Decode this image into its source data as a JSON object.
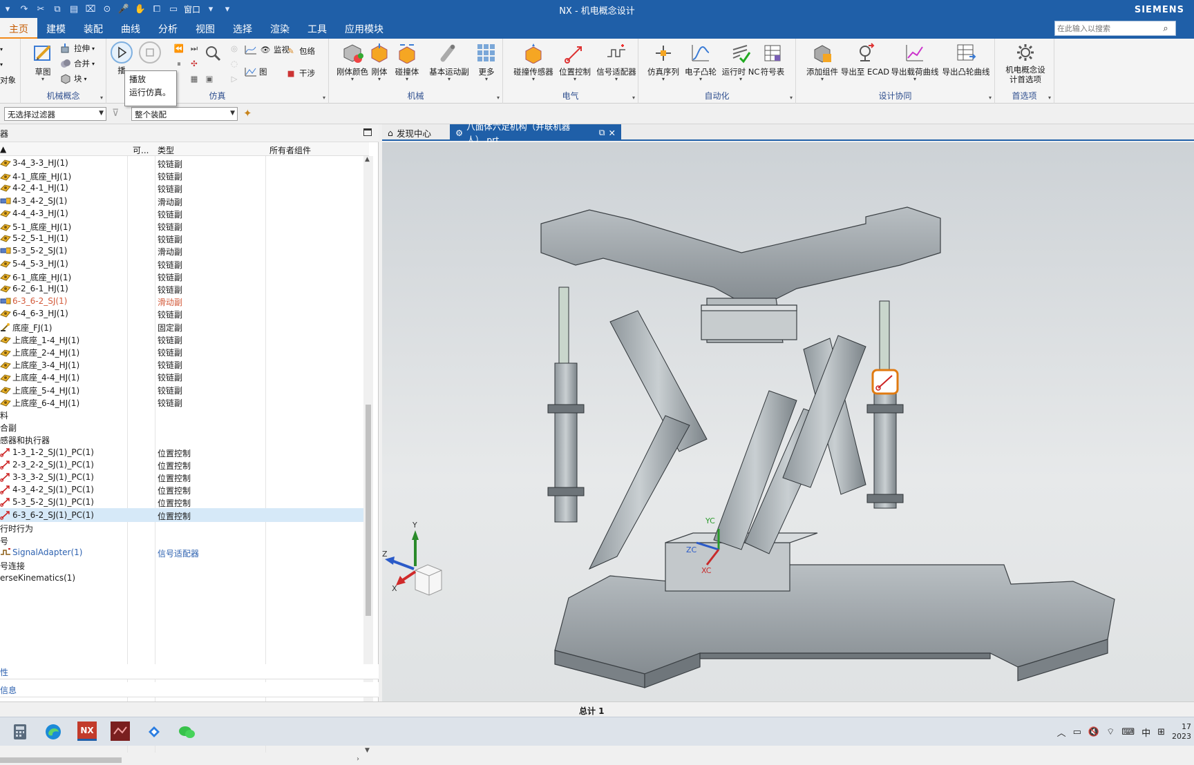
{
  "titlebar": {
    "title": "NX - 机电概念设计",
    "brand": "SIEMENS",
    "window_menu": "窗口"
  },
  "menu": {
    "tabs": [
      "主页",
      "建模",
      "装配",
      "曲线",
      "分析",
      "视图",
      "选择",
      "渲染",
      "工具",
      "应用模块"
    ],
    "active_tab": "主页",
    "search_placeholder": "在此输入以搜索"
  },
  "ribbon": {
    "group_labels": {
      "mech_concept": "机械概念",
      "simulation": "仿真",
      "mechanical": "机械",
      "electrical": "电气",
      "automation": "自动化",
      "design_collab": "设计协同",
      "preferences": "首选项"
    },
    "left_clip": {
      "obj": "对象"
    },
    "mech_concept": {
      "sketch": "草图",
      "extrude": "拉伸",
      "unite": "合并",
      "block": "块"
    },
    "simulation": {
      "play_clip": "播",
      "monitor": "监视",
      "chart": "图",
      "wrap": "包络",
      "interference": "干涉"
    },
    "mechanical": {
      "rigid_color": "刚体颜色",
      "rigid": "刚体",
      "collision": "碰撞体",
      "basic_joint": "基本运动副",
      "more": "更多"
    },
    "electrical": {
      "collision_sensor": "碰撞传感器",
      "position_control": "位置控制",
      "signal_adapter": "信号适配器"
    },
    "automation": {
      "sim_sequence": "仿真序列",
      "e_cam": "电子凸轮",
      "runtime_nc": "运行时 NC",
      "symbol_table": "符号表"
    },
    "design_collab": {
      "add_component": "添加组件",
      "export_ecad": "导出至 ECAD",
      "export_load_curve": "导出载荷曲线",
      "export_cam_curve": "导出凸轮曲线"
    },
    "preferences": {
      "mcd_pref_line1": "机电概念设",
      "mcd_pref_line2": "计首选项"
    }
  },
  "tooltip": {
    "title": "播放",
    "desc": "运行仿真。"
  },
  "filterbar": {
    "selection_filter": "无选择过滤器",
    "scope": "整个装配"
  },
  "navigator": {
    "title": "器",
    "columns": [
      "",
      "可...",
      "类型",
      "所有者组件"
    ],
    "rows": [
      {
        "name": "3-4_3-3_HJ(1)",
        "type": "铰链副",
        "icon": "hinge",
        "style": ""
      },
      {
        "name": "4-1_底座_HJ(1)",
        "type": "铰链副",
        "icon": "hinge",
        "style": ""
      },
      {
        "name": "4-2_4-1_HJ(1)",
        "type": "铰链副",
        "icon": "hinge",
        "style": ""
      },
      {
        "name": "4-3_4-2_SJ(1)",
        "type": "滑动副",
        "icon": "slider",
        "style": ""
      },
      {
        "name": "4-4_4-3_HJ(1)",
        "type": "铰链副",
        "icon": "hinge",
        "style": ""
      },
      {
        "name": "5-1_底座_HJ(1)",
        "type": "铰链副",
        "icon": "hinge",
        "style": ""
      },
      {
        "name": "5-2_5-1_HJ(1)",
        "type": "铰链副",
        "icon": "hinge",
        "style": ""
      },
      {
        "name": "5-3_5-2_SJ(1)",
        "type": "滑动副",
        "icon": "slider",
        "style": ""
      },
      {
        "name": "5-4_5-3_HJ(1)",
        "type": "铰链副",
        "icon": "hinge",
        "style": ""
      },
      {
        "name": "6-1_底座_HJ(1)",
        "type": "铰链副",
        "icon": "hinge",
        "style": ""
      },
      {
        "name": "6-2_6-1_HJ(1)",
        "type": "铰链副",
        "icon": "hinge",
        "style": ""
      },
      {
        "name": "6-3_6-2_SJ(1)",
        "type": "滑动副",
        "icon": "slider",
        "style": "red"
      },
      {
        "name": "6-4_6-3_HJ(1)",
        "type": "铰链副",
        "icon": "hinge",
        "style": ""
      },
      {
        "name": "底座_FJ(1)",
        "type": "固定副",
        "icon": "fixed",
        "style": ""
      },
      {
        "name": "上底座_1-4_HJ(1)",
        "type": "铰链副",
        "icon": "hinge",
        "style": ""
      },
      {
        "name": "上底座_2-4_HJ(1)",
        "type": "铰链副",
        "icon": "hinge",
        "style": ""
      },
      {
        "name": "上底座_3-4_HJ(1)",
        "type": "铰链副",
        "icon": "hinge",
        "style": ""
      },
      {
        "name": "上底座_4-4_HJ(1)",
        "type": "铰链副",
        "icon": "hinge",
        "style": ""
      },
      {
        "name": "上底座_5-4_HJ(1)",
        "type": "铰链副",
        "icon": "hinge",
        "style": ""
      },
      {
        "name": "上底座_6-4_HJ(1)",
        "type": "铰链副",
        "icon": "hinge",
        "style": ""
      },
      {
        "name": "料",
        "type": "",
        "icon": "",
        "style": ""
      },
      {
        "name": "合副",
        "type": "",
        "icon": "",
        "style": ""
      },
      {
        "name": "感器和执行器",
        "type": "",
        "icon": "",
        "style": ""
      },
      {
        "name": "1-3_1-2_SJ(1)_PC(1)",
        "type": "位置控制",
        "icon": "pc",
        "style": ""
      },
      {
        "name": "2-3_2-2_SJ(1)_PC(1)",
        "type": "位置控制",
        "icon": "pc",
        "style": ""
      },
      {
        "name": "3-3_3-2_SJ(1)_PC(1)",
        "type": "位置控制",
        "icon": "pc",
        "style": ""
      },
      {
        "name": "4-3_4-2_SJ(1)_PC(1)",
        "type": "位置控制",
        "icon": "pc",
        "style": ""
      },
      {
        "name": "5-3_5-2_SJ(1)_PC(1)",
        "type": "位置控制",
        "icon": "pc",
        "style": ""
      },
      {
        "name": "6-3_6-2_SJ(1)_PC(1)",
        "type": "位置控制",
        "icon": "pc",
        "style": "sel"
      },
      {
        "name": "行时行为",
        "type": "",
        "icon": "",
        "style": ""
      },
      {
        "name": "号",
        "type": "",
        "icon": "",
        "style": ""
      },
      {
        "name": "SignalAdapter(1)",
        "type": "信号适配器",
        "icon": "sa",
        "style": "blue"
      },
      {
        "name": "号连接",
        "type": "",
        "icon": "",
        "style": ""
      },
      {
        "name": "erseKinematics(1)",
        "type": "",
        "icon": "",
        "style": ""
      }
    ],
    "panels": [
      "性",
      "信息"
    ]
  },
  "graphics_tabs": {
    "discovery": "发现中心",
    "part": "八面体六足机构（并联机器人）.prt"
  },
  "triad": {
    "x": "X",
    "y": "Y",
    "z": "Z"
  },
  "wcs": {
    "xc": "XC",
    "yc": "YC",
    "zc": "ZC"
  },
  "status": {
    "total": "总计 1"
  },
  "taskbar": {
    "ime": "中",
    "time": "17",
    "date": "2023"
  }
}
